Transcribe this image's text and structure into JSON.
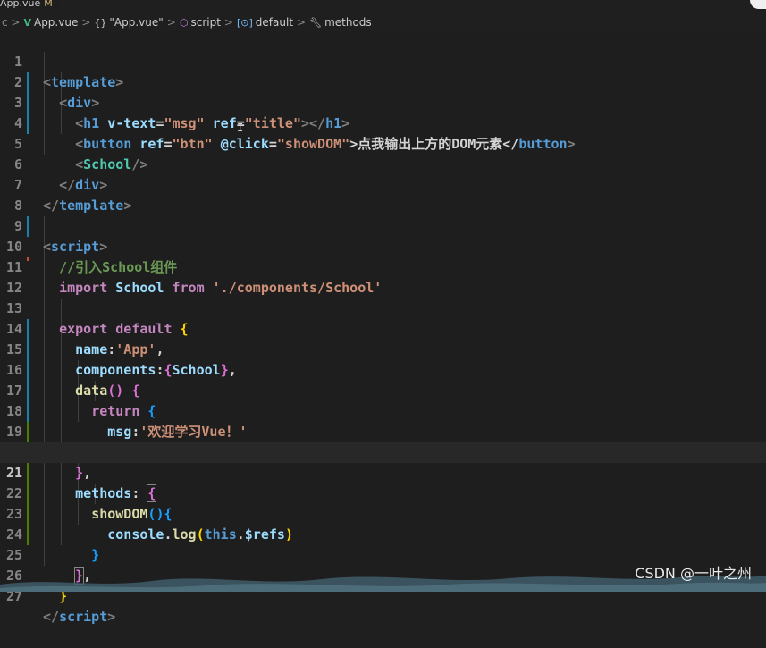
{
  "tab": {
    "label": "App.vue",
    "modified": "M"
  },
  "breadcrumb": {
    "items": [
      {
        "icon": "vue-icon",
        "label": "App.vue"
      },
      {
        "icon": "braces-icon",
        "label": "\"App.vue\""
      },
      {
        "icon": "cube-icon",
        "label": "script"
      },
      {
        "icon": "variable-icon",
        "label": "default"
      },
      {
        "icon": "wrench-icon",
        "label": "methods"
      }
    ]
  },
  "editor": {
    "active_line": 21,
    "lines": [
      {
        "n": "1"
      },
      {
        "n": "2"
      },
      {
        "n": "3"
      },
      {
        "n": "4"
      },
      {
        "n": "5"
      },
      {
        "n": "6"
      },
      {
        "n": "7"
      },
      {
        "n": "8"
      },
      {
        "n": "9"
      },
      {
        "n": "10"
      },
      {
        "n": "11"
      },
      {
        "n": "12"
      },
      {
        "n": "13"
      },
      {
        "n": "14"
      },
      {
        "n": "15"
      },
      {
        "n": "16"
      },
      {
        "n": "17"
      },
      {
        "n": "18"
      },
      {
        "n": "19"
      },
      {
        "n": "20"
      },
      {
        "n": "21"
      },
      {
        "n": "22"
      },
      {
        "n": "23"
      },
      {
        "n": "24"
      },
      {
        "n": "25"
      },
      {
        "n": "26"
      },
      {
        "n": "27"
      }
    ],
    "code": {
      "l1": [
        "<",
        "template",
        ">"
      ],
      "l2": [
        "<",
        "div",
        ">"
      ],
      "l3": [
        "<",
        "h1",
        "v-text",
        "=",
        "\"msg\"",
        "ref",
        "=",
        "\"title\"",
        "></",
        "h1",
        ">"
      ],
      "l4": [
        "<",
        "button",
        "ref",
        "=",
        "\"btn\"",
        "@click",
        "=",
        "\"showDOM\"",
        ">点我输出上方的DOM元素</",
        "button",
        ">"
      ],
      "l5": [
        "<",
        "School",
        "/>"
      ],
      "l6": [
        "</",
        "div",
        ">"
      ],
      "l7": [
        "</",
        "template",
        ">"
      ],
      "l9": [
        "<",
        "script",
        ">"
      ],
      "l10": [
        "//引入School组件"
      ],
      "l11": [
        "import",
        "School",
        "from",
        "'./components/School'"
      ],
      "l13": [
        "export",
        "default",
        "{"
      ],
      "l14": [
        "name",
        ":",
        "'App'",
        ","
      ],
      "l15": [
        "components",
        ":",
        "{",
        "School",
        "}",
        ","
      ],
      "l16": [
        "data",
        "(",
        ")",
        "{"
      ],
      "l17": [
        "return",
        "{"
      ],
      "l18": [
        "msg",
        ":",
        "'欢迎学习Vue！'"
      ],
      "l19": [
        "}"
      ],
      "l20": [
        "}",
        ","
      ],
      "l21": [
        "methods",
        ":",
        "{"
      ],
      "l22": [
        "showDOM",
        "(",
        ")",
        "{"
      ],
      "l23": [
        "console",
        ".",
        "log",
        "(",
        "this",
        ".",
        "$refs",
        ")"
      ],
      "l24": [
        "}"
      ],
      "l25": [
        "}",
        ","
      ],
      "l26": [
        "}"
      ],
      "l27": [
        "</",
        "script",
        ">"
      ]
    }
  },
  "watermark": "CSDN @一叶之州",
  "colors": {
    "background": "#1e1e1e",
    "tag": "#569cd6",
    "attribute": "#9cdcfe",
    "string": "#ce9178",
    "keyword": "#c586c0",
    "component": "#4ec9b0",
    "function": "#dcdcaa",
    "comment": "#6a9955"
  }
}
